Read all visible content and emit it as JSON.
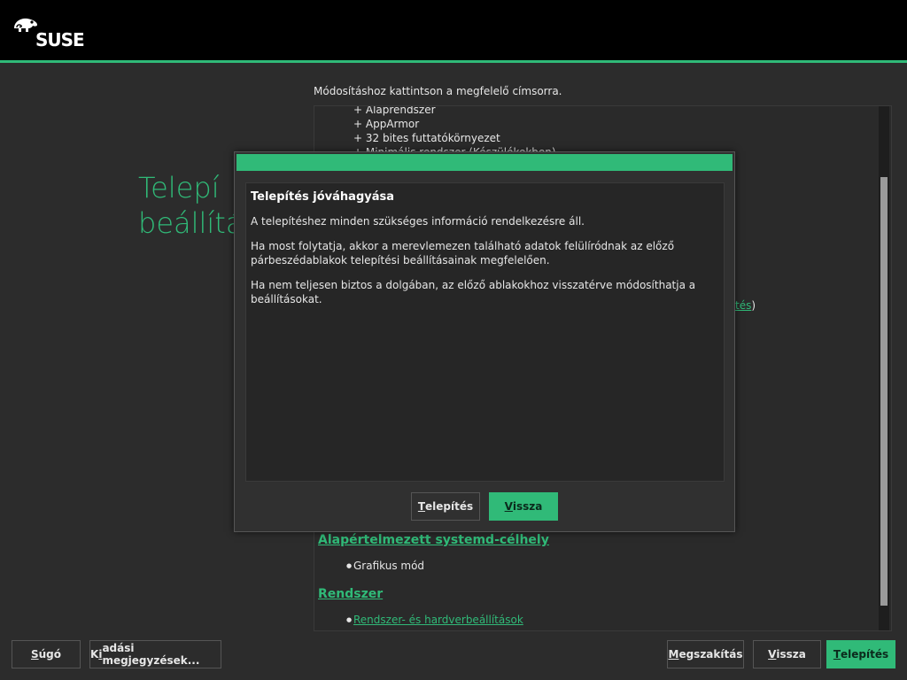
{
  "brand": {
    "logo_text": "SUSE",
    "accent_color": "#30ba78"
  },
  "page": {
    "title_line1": "Telepí",
    "title_line2": "beállítá"
  },
  "overview": {
    "hint": "Módosításhoz kattintson a megfelelő címsorra.",
    "software_items": [
      "+ Alaprendszer",
      "+ AppArmor",
      "+ 32 bites futtatókörnyezet",
      "+ Minimális rendszer (Készülékekben)"
    ],
    "partial_link_text": "tés",
    "partial_link_paren": ")",
    "systemd_heading": "Alapértelmezett systemd-célhely",
    "systemd_item": "Grafikus mód",
    "system_heading": "Rendszer",
    "system_item": "Rendszer- és hardverbeállítások"
  },
  "dialog": {
    "heading": "Telepítés jóváhagyása",
    "para1": "A telepítéshez minden szükséges információ rendelkezésre áll.",
    "para2": "Ha most folytatja, akkor a merevlemezen található adatok felülíródnak az előző párbeszédablakok telepítési beállításainak megfelelően.",
    "para3": "Ha nem teljesen biztos a dolgában, az előző ablakokhoz visszatérve módosíthatja a beállításokat.",
    "install_label_mn": "T",
    "install_label_rest": "elepítés",
    "back_label_mn": "V",
    "back_label_rest": "issza"
  },
  "footer": {
    "help_mn": "S",
    "help_rest": "úgó",
    "release_pre": "K",
    "release_mn": "i",
    "release_rest": "adási megjegyzések...",
    "abort_mn": "M",
    "abort_rest": "egszakítás",
    "back_mn": "V",
    "back_rest": "issza",
    "install_mn": "T",
    "install_rest": "elepítés"
  }
}
